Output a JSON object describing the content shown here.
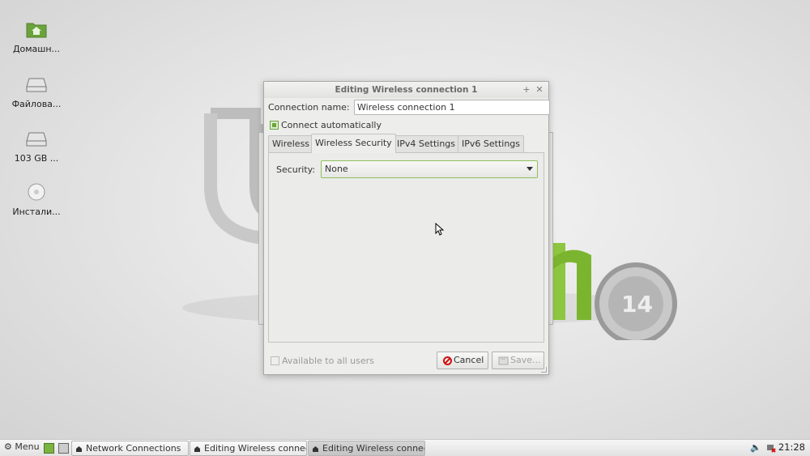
{
  "desktop": {
    "icons": [
      {
        "label": "Домашн...",
        "icon": "home-folder-icon"
      },
      {
        "label": "Файлова...",
        "icon": "drive-icon"
      },
      {
        "label": "103 GB ...",
        "icon": "drive-icon"
      },
      {
        "label": "Инстали...",
        "icon": "disc-installer-icon"
      }
    ]
  },
  "dialog": {
    "title": "Editing Wireless connection 1",
    "connection_name_label": "Connection name:",
    "connection_name_value": "Wireless connection 1",
    "connect_automatically_label": "Connect automatically",
    "connect_automatically_checked": true,
    "tabs": [
      "Wireless",
      "Wireless Security",
      "IPv4 Settings",
      "IPv6 Settings"
    ],
    "active_tab": "Wireless Security",
    "security_label": "Security:",
    "security_value": "None",
    "available_to_all_label": "Available to all users",
    "cancel_label": "Cancel",
    "save_label": "Save..."
  },
  "taskbar": {
    "menu_label": "Menu",
    "tasks": [
      {
        "label": "Network Connections",
        "active": false
      },
      {
        "label": "Editing Wireless connec...",
        "active": false
      },
      {
        "label": "Editing Wireless connec...",
        "active": true
      }
    ],
    "clock": "21:28"
  },
  "colors": {
    "accent": "#8fbf5e",
    "mint_green": "#8dc63f"
  }
}
